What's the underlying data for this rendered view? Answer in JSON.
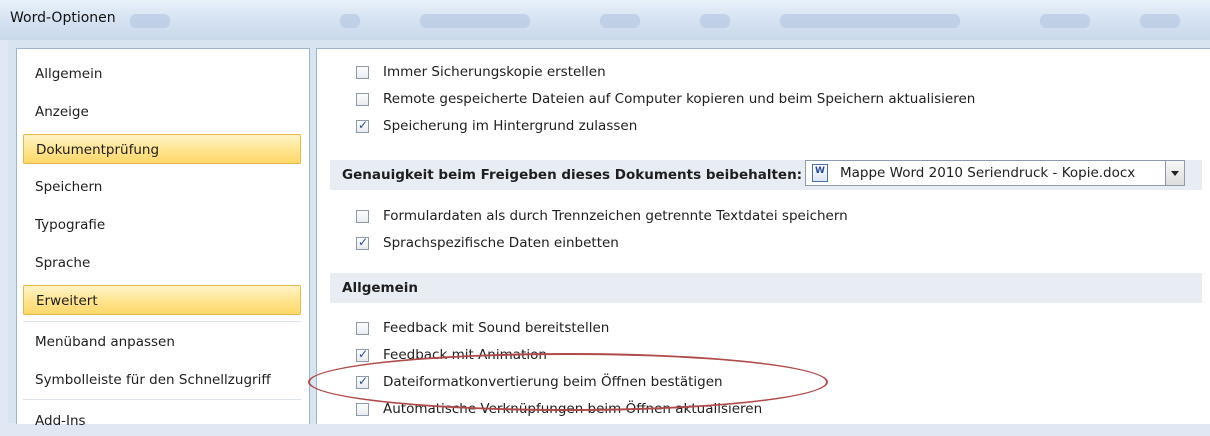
{
  "window": {
    "title": "Word-Optionen"
  },
  "sidebar": {
    "items": [
      {
        "label": "Allgemein",
        "active": false
      },
      {
        "label": "Anzeige",
        "active": false
      },
      {
        "label": "Dokumentprüfung",
        "active": true
      },
      {
        "label": "Speichern",
        "active": false
      },
      {
        "label": "Typografie",
        "active": false
      },
      {
        "label": "Sprache",
        "active": false
      },
      {
        "label": "Erweitert",
        "active": true
      },
      {
        "label": "Menüband anpassen",
        "active": false
      },
      {
        "label": "Symbolleiste für den Schnellzugriff",
        "active": false
      },
      {
        "label": "Add-Ins",
        "active": false
      }
    ]
  },
  "content": {
    "save_options": [
      {
        "label": "Immer Sicherungskopie erstellen",
        "checked": false
      },
      {
        "label": "Remote gespeicherte Dateien auf Computer kopieren und beim Speichern aktualisieren",
        "checked": false
      },
      {
        "label": "Speicherung im Hintergrund zulassen",
        "checked": true
      }
    ],
    "fidelity": {
      "label": "Genauigkeit beim Freigeben dieses Dokuments beibehalten:",
      "document": "Mappe Word 2010 Seriendruck - Kopie.docx"
    },
    "fidelity_options": [
      {
        "label": "Formulardaten als durch Trennzeichen getrennte Textdatei speichern",
        "checked": false
      },
      {
        "label": "Sprachspezifische Daten einbetten",
        "checked": true
      }
    ],
    "general_section": {
      "title": "Allgemein",
      "options": [
        {
          "label": "Feedback mit Sound bereitstellen",
          "checked": false
        },
        {
          "label": "Feedback mit Animation",
          "checked": true
        },
        {
          "label": "Dateiformatkonvertierung beim Öffnen bestätigen",
          "checked": true
        },
        {
          "label": "Automatische Verknüpfungen beim Öffnen aktualisieren",
          "checked": false
        }
      ]
    }
  },
  "colors": {
    "highlight_ellipse": "#b04a4a",
    "active_nav": "#ffd86a"
  }
}
